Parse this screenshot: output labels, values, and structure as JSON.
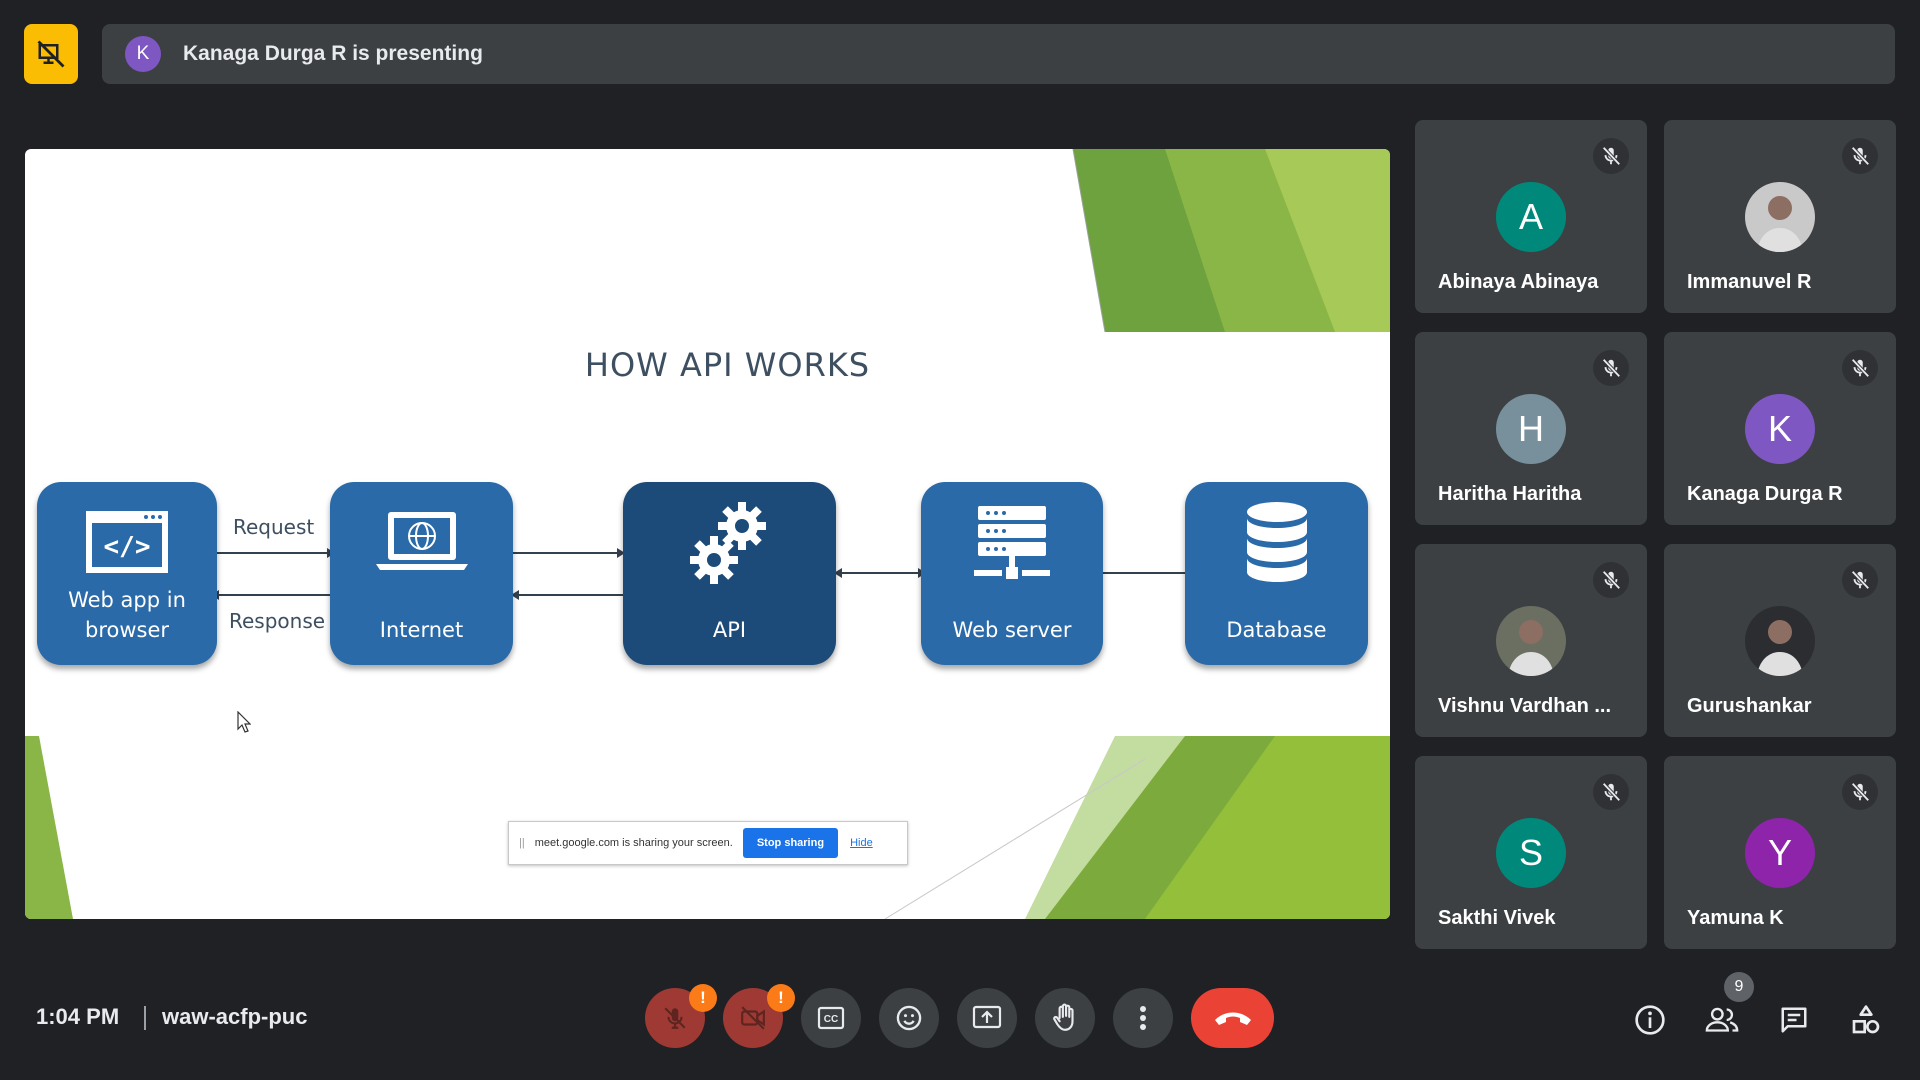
{
  "presenter": {
    "initial": "K",
    "text": "Kanaga Durga R is presenting"
  },
  "slide": {
    "title": "HOW API WORKS",
    "boxes": [
      {
        "label": "Web app in browser",
        "icon": "code-window-icon"
      },
      {
        "label": "Internet",
        "icon": "laptop-globe-icon"
      },
      {
        "label": "API",
        "icon": "gears-icon"
      },
      {
        "label": "Web server",
        "icon": "server-icon"
      },
      {
        "label": "Database",
        "icon": "database-icon"
      }
    ],
    "request_label": "Request",
    "response_label": "Response"
  },
  "share_notice": {
    "text": "meet.google.com is sharing your screen.",
    "stop_label": "Stop sharing",
    "hide_label": "Hide"
  },
  "participants": [
    {
      "name": "Abinaya Abinaya",
      "initial": "A",
      "color": "#00897b",
      "muted": true
    },
    {
      "name": "Immanuvel R",
      "initial": "",
      "color": "#c9c9c9",
      "muted": true
    },
    {
      "name": "Haritha Haritha",
      "initial": "H",
      "color": "#78909c",
      "muted": true
    },
    {
      "name": "Kanaga Durga R",
      "initial": "K",
      "color": "#7e57c2",
      "muted": true
    },
    {
      "name": "Vishnu Vardhan ...",
      "initial": "",
      "color": "#6a6f62",
      "muted": true
    },
    {
      "name": "Gurushankar",
      "initial": "",
      "color": "#2b2d30",
      "muted": true
    },
    {
      "name": "Sakthi Vivek",
      "initial": "S",
      "color": "#00897b",
      "muted": true
    },
    {
      "name": "Yamuna K",
      "initial": "Y",
      "color": "#8e24aa",
      "muted": true
    }
  ],
  "meeting": {
    "time": "1:04 PM",
    "code": "waw-acfp-puc",
    "participant_count": "9"
  },
  "warnings": {
    "mic": "!",
    "camera": "!"
  }
}
